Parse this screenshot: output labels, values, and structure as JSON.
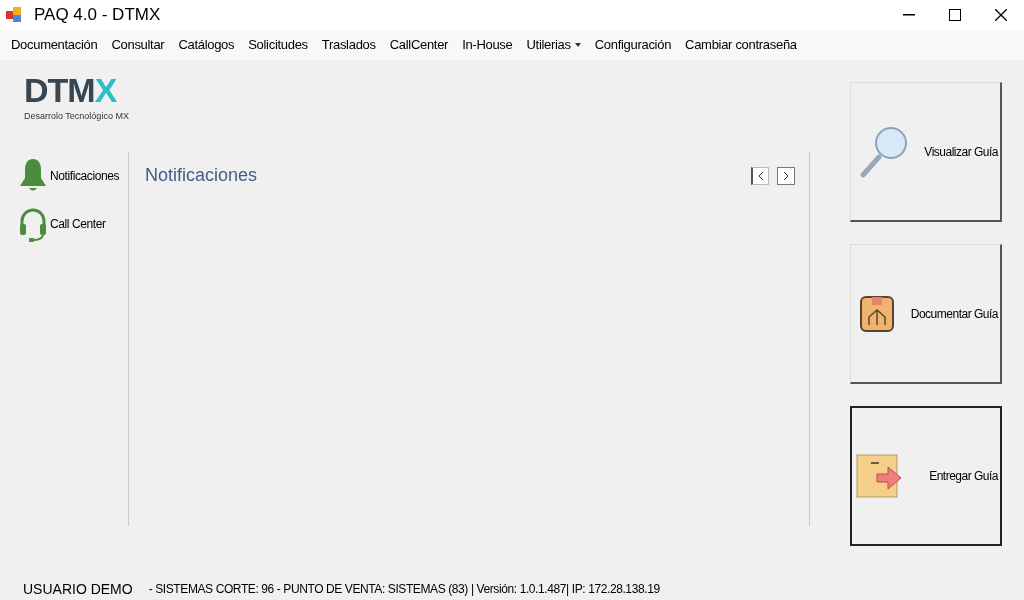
{
  "window": {
    "title": "PAQ 4.0 - DTMX"
  },
  "menu": [
    {
      "label": "Documentación",
      "kind": "item"
    },
    {
      "label": "Consultar",
      "kind": "item"
    },
    {
      "label": "Catálogos",
      "kind": "item"
    },
    {
      "label": "Solicitudes",
      "kind": "item"
    },
    {
      "label": "Traslados",
      "kind": "item"
    },
    {
      "label": "CallCenter",
      "kind": "item"
    },
    {
      "label": "In-House",
      "kind": "item"
    },
    {
      "label": "Utilerias",
      "kind": "dropdown"
    },
    {
      "label": "Configuración",
      "kind": "item"
    },
    {
      "label": "Cambiar contraseña",
      "kind": "item"
    }
  ],
  "logo": {
    "text": "DTMX",
    "subtitle": "Desarrolo Tecnológico MX"
  },
  "sidebar": {
    "items": [
      {
        "label": "Notificaciones",
        "kind": "bell"
      },
      {
        "label": "Call Center",
        "kind": "headset"
      }
    ]
  },
  "panel": {
    "title": "Notificaciones"
  },
  "actions": [
    {
      "label": "Visualizar Guía",
      "kind": "search",
      "focused": false
    },
    {
      "label": "Documentar Guía",
      "kind": "box",
      "focused": false
    },
    {
      "label": "Entregar Guía",
      "kind": "deliver",
      "focused": true
    }
  ],
  "status_bar": {
    "user": "USUARIO DEMO",
    "info": "- SISTEMAS CORTE: 96 - PUNTO DE VENTA: SISTEMAS (83) | Versión: 1.0.1.487| IP: 172.28.138.19"
  }
}
